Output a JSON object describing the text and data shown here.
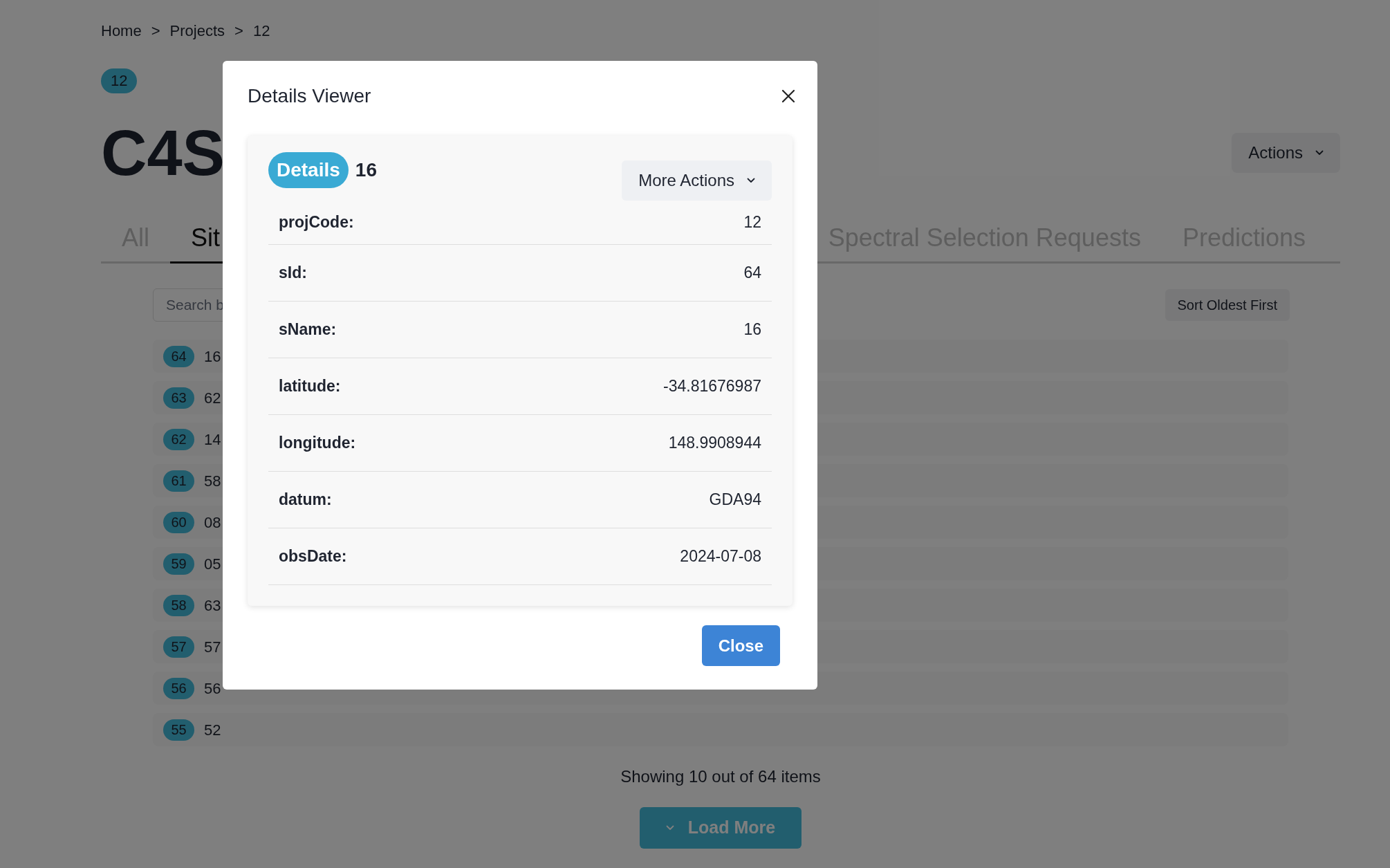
{
  "breadcrumb": [
    "Home",
    ">",
    "Projects",
    ">",
    "12"
  ],
  "project": {
    "badge": "12",
    "title": "C4S"
  },
  "actions_button": "Actions",
  "tabs": [
    {
      "label": "All",
      "selected": false
    },
    {
      "label": "Sit",
      "selected": true
    },
    {
      "label": "Spectral Selection Requests",
      "selected": false
    },
    {
      "label": "Predictions",
      "selected": false
    }
  ],
  "search": {
    "placeholder": "Search b"
  },
  "sort_button": "Sort Oldest First",
  "rows": [
    {
      "id": "64",
      "name": "16"
    },
    {
      "id": "63",
      "name": "62"
    },
    {
      "id": "62",
      "name": "14"
    },
    {
      "id": "61",
      "name": "58"
    },
    {
      "id": "60",
      "name": "08"
    },
    {
      "id": "59",
      "name": "05"
    },
    {
      "id": "58",
      "name": "63"
    },
    {
      "id": "57",
      "name": "57"
    },
    {
      "id": "56",
      "name": "56"
    },
    {
      "id": "55",
      "name": "52"
    }
  ],
  "footer": "Showing 10 out of 64 items",
  "load_more": "Load More",
  "dialog": {
    "title": "Details Viewer",
    "badge": "Details",
    "name": "16",
    "more_actions": "More Actions",
    "fields": [
      {
        "label": "projCode:",
        "value": "12"
      },
      {
        "label": "sId:",
        "value": "64"
      },
      {
        "label": "sName:",
        "value": "16"
      },
      {
        "label": "latitude:",
        "value": "-34.81676987"
      },
      {
        "label": "longitude:",
        "value": "148.9908944"
      },
      {
        "label": "datum:",
        "value": "GDA94"
      },
      {
        "label": "obsDate:",
        "value": "2024-07-08"
      }
    ],
    "close_button": "Close"
  }
}
